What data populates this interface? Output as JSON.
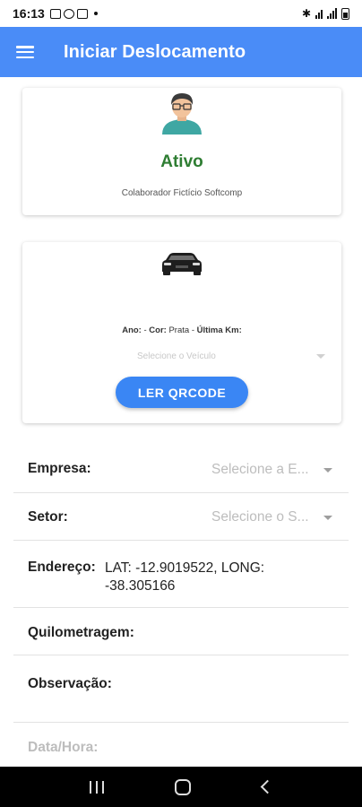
{
  "status_bar": {
    "time": "16:13",
    "icons": [
      "image-icon",
      "whatsapp-icon",
      "cast-icon",
      "bluetooth-icon",
      "wifi-icon",
      "signal-icon",
      "battery-icon"
    ]
  },
  "app_bar": {
    "title": "Iniciar Deslocamento",
    "color": "#4a8cf7"
  },
  "user_card": {
    "status": "Ativo",
    "status_color": "#2e7d32",
    "collaborator": "Colaborador Fictício Softcomp"
  },
  "vehicle_card": {
    "info_ano": "Ano:",
    "info_ano_value": "- ",
    "info_cor": "Cor:",
    "info_cor_value": " Prata - ",
    "info_km": "Última Km:",
    "select_placeholder": "Selecione o Veículo",
    "qr_button": "LER QRCODE"
  },
  "form": {
    "empresa_label": "Empresa:",
    "empresa_placeholder": "Selecione a E...",
    "setor_label": "Setor:",
    "setor_placeholder": "Selecione o S...",
    "endereco_label": "Endereço:",
    "endereco_value": "LAT: -12.9019522, LONG: -38.305166",
    "quilometragem_label": "Quilometragem:",
    "observacao_label": "Observação:",
    "datahora_label": "Data/Hora:"
  }
}
